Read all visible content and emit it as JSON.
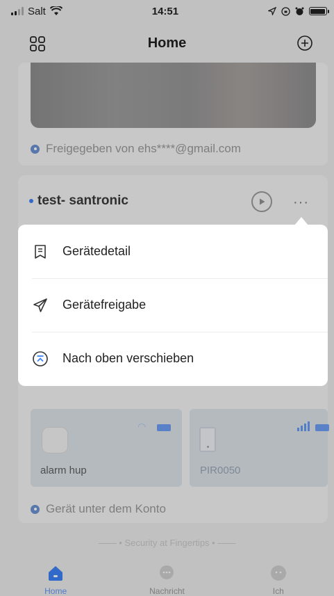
{
  "status_bar": {
    "carrier": "Salt",
    "time": "14:51"
  },
  "header": {
    "title": "Home"
  },
  "shared_card": {
    "shared_from": "Freigegeben von ehs****@gmail.com"
  },
  "device_card": {
    "name": "test- santronic",
    "tiles": [
      {
        "label": "alarm hup"
      },
      {
        "label": "PIR0050"
      }
    ],
    "account_note": "Gerät unter dem Konto"
  },
  "footer_slogan": "—— • Security at Fingertips • ——",
  "tabs": [
    {
      "label": "Home"
    },
    {
      "label": "Nachricht"
    },
    {
      "label": "Ich"
    }
  ],
  "menu": {
    "items": [
      {
        "label": "Gerätedetail",
        "icon": "document-icon"
      },
      {
        "label": "Gerätefreigabe",
        "icon": "send-icon"
      },
      {
        "label": "Nach oben verschieben",
        "icon": "move-top-icon"
      }
    ]
  },
  "colors": {
    "accent": "#3e82f7",
    "overlay": "rgba(0,0,0,0.18)"
  }
}
